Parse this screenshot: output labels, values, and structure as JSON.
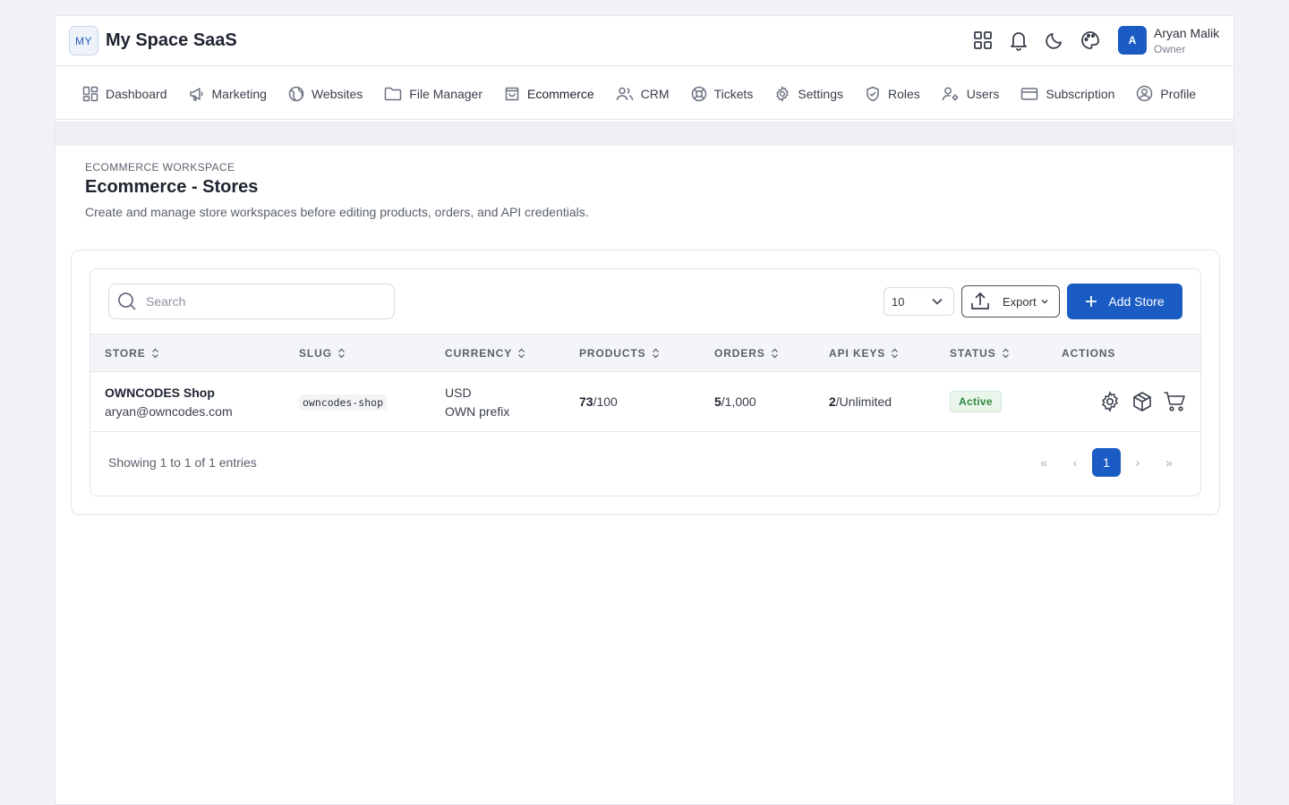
{
  "app": {
    "logo_text": "MY",
    "title": "My Space SaaS"
  },
  "header": {
    "icons": [
      "apps-grid-icon",
      "bell-icon",
      "moon-icon",
      "palette-icon"
    ],
    "user": {
      "initial": "A",
      "name": "Aryan Malik",
      "role": "Owner"
    }
  },
  "nav": {
    "items": [
      {
        "label": "Dashboard",
        "icon": "dashboard-icon"
      },
      {
        "label": "Marketing",
        "icon": "megaphone-icon"
      },
      {
        "label": "Websites",
        "icon": "globe-icon"
      },
      {
        "label": "File Manager",
        "icon": "folder-icon"
      },
      {
        "label": "Ecommerce",
        "icon": "shopping-bag-icon",
        "active": true
      },
      {
        "label": "CRM",
        "icon": "users-icon"
      },
      {
        "label": "Tickets",
        "icon": "lifebuoy-icon"
      },
      {
        "label": "Settings",
        "icon": "gear-icon"
      },
      {
        "label": "Roles",
        "icon": "shield-icon"
      },
      {
        "label": "Users",
        "icon": "user-cog-icon"
      },
      {
        "label": "Subscription",
        "icon": "credit-card-icon"
      },
      {
        "label": "Profile",
        "icon": "user-circle-icon"
      }
    ]
  },
  "page": {
    "kicker": "ECOMMERCE WORKSPACE",
    "title": "Ecommerce - Stores",
    "description": "Create and manage store workspaces before editing products, orders, and API credentials."
  },
  "toolbar": {
    "search_placeholder": "Search",
    "search_value": "",
    "page_size": "10",
    "export_label": "Export",
    "add_label": "Add Store"
  },
  "table": {
    "columns": [
      "STORE",
      "SLUG",
      "CURRENCY",
      "PRODUCTS",
      "ORDERS",
      "API KEYS",
      "STATUS",
      "ACTIONS"
    ],
    "rows": [
      {
        "store_name": "OWNCODES Shop",
        "store_email": "aryan@owncodes.com",
        "slug": "owncodes-shop",
        "currency": "USD",
        "currency_prefix": "OWN prefix",
        "products_used": "73",
        "products_limit": "/100",
        "orders_used": "5",
        "orders_limit": "/1,000",
        "api_keys_used": "2",
        "api_keys_limit": "/Unlimited",
        "status": "Active",
        "actions": [
          "gear-icon",
          "box-icon",
          "cart-icon"
        ]
      }
    ]
  },
  "footer": {
    "summary": "Showing 1 to 1 of 1 entries",
    "pager": {
      "first": "«",
      "prev": "‹",
      "current": "1",
      "next": "›",
      "last": "»"
    }
  },
  "colors": {
    "accent": "#1b5cc4",
    "status_active": "#2f8a3f",
    "background": "#f0f2f6"
  }
}
